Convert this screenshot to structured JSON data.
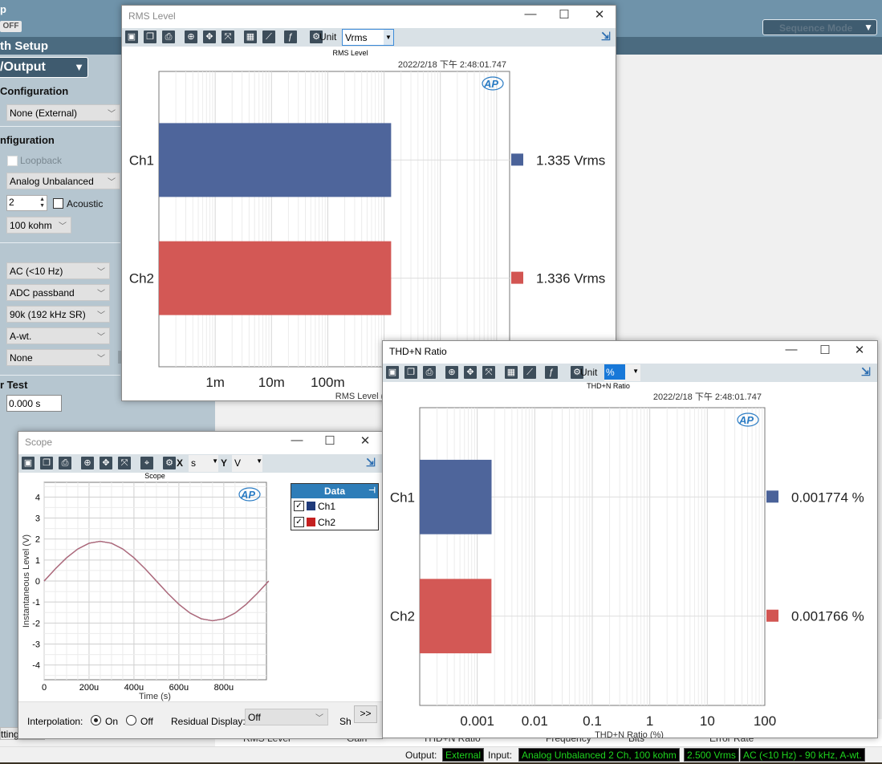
{
  "app": {
    "top_label": "p",
    "off_button": "OFF",
    "path_setup_title": "th Setup",
    "io_dropdown": "/Output",
    "sequence_mode": "Sequence Mode",
    "settings_button": "ttings"
  },
  "left_panel": {
    "section1_title": "Configuration",
    "section1_select": "None (External)",
    "section2_title": "nfiguration",
    "loopback_label": "Loopback",
    "connector_select": "Analog Unbalanced",
    "channels_value": "2",
    "acoustic_label": "Acoustic",
    "impedance_select": "100 kohm",
    "coupling_select": "AC (<10 Hz)",
    "bandpass_select": "ADC passband",
    "lowpass_select": "90k (192 kHz SR)",
    "weighting_select": "A-wt.",
    "filter_select": "None",
    "section3_title": "r Test",
    "delay_value": "0.000 s"
  },
  "bottom_tabs": [
    "RMS Level",
    "Gain",
    "THD+N Ratio",
    "Frequency",
    "Bits",
    "Error Rate"
  ],
  "status": {
    "output_label": "Output:",
    "output_value": "External",
    "input_label": "Input:",
    "input_value": "Analog Unbalanced 2 Ch, 100 kohm",
    "range_value": "2.500 Vrms",
    "filter_value": "AC (<10 Hz) - 90 kHz, A-wt.",
    "badge_text_color": "#1ed41e"
  },
  "toolbar_icons": [
    "save-icon",
    "copy-icon",
    "print-icon",
    "zoom-icon",
    "pan-icon",
    "fit-icon",
    "table-icon",
    "graph-options-icon",
    "function-icon",
    "settings-icon"
  ],
  "colors": {
    "ch1": "#4a6299",
    "ch2": "#d25552",
    "scope_ch1": "#1f3a7a",
    "scope_ch2": "#c42020",
    "toolbar_bg": "#d9e1e6",
    "data_header": "#2e7db8"
  },
  "rms_window": {
    "title": "RMS Level",
    "unit_label": "Unit",
    "unit_value": "Vrms",
    "chart_title": "RMS Level",
    "timestamp": "2022/2/18 下午 2:48:01.747",
    "logo": "AP"
  },
  "thd_window": {
    "title": "THD+N Ratio",
    "unit_label": "Unit",
    "unit_value": "%",
    "chart_title": "THD+N Ratio",
    "timestamp": "2022/2/18 下午 2:48:01.747",
    "logo": "AP"
  },
  "scope_window": {
    "title": "Scope",
    "x_label": "X",
    "x_unit": "s",
    "y_label": "Y",
    "y_unit": "V",
    "chart_title": "Scope",
    "logo": "AP",
    "legend_title": "Data",
    "legend_items": [
      {
        "name": "Ch1",
        "checked": true
      },
      {
        "name": "Ch2",
        "checked": true
      }
    ],
    "interpolation_label": "Interpolation:",
    "interp_on": "On",
    "interp_off": "Off",
    "interp_selected": "On",
    "residual_label": "Residual Display:",
    "residual_value": "Off",
    "show_label": "Sh",
    "more_button": ">>"
  },
  "chart_data": [
    {
      "type": "bar",
      "orientation": "horizontal",
      "title": "RMS Level",
      "xlabel": "RMS Level (Vrms)",
      "xscale": "log",
      "xlim": [
        0.0001,
        170
      ],
      "xticks": [
        {
          "v": 0.001,
          "label": "1m"
        },
        {
          "v": 0.01,
          "label": "10m"
        },
        {
          "v": 0.1,
          "label": "100m"
        }
      ],
      "categories": [
        "Ch1",
        "Ch2"
      ],
      "values": [
        1.335,
        1.336
      ],
      "value_labels": [
        "1.335  Vrms",
        "1.336  Vrms"
      ],
      "grid": true
    },
    {
      "type": "bar",
      "orientation": "horizontal",
      "title": "THD+N Ratio",
      "xlabel": "THD+N Ratio (%)",
      "xscale": "log",
      "xlim": [
        0.0001,
        100
      ],
      "xticks": [
        {
          "v": 0.001,
          "label": "0.001"
        },
        {
          "v": 0.01,
          "label": "0.01"
        },
        {
          "v": 0.1,
          "label": "0.1"
        },
        {
          "v": 1,
          "label": "1"
        },
        {
          "v": 10,
          "label": "10"
        },
        {
          "v": 100,
          "label": "100"
        }
      ],
      "categories": [
        "Ch1",
        "Ch2"
      ],
      "values": [
        0.001774,
        0.001766
      ],
      "value_labels": [
        "0.001774  %",
        "0.001766  %"
      ],
      "grid": true
    },
    {
      "type": "line",
      "title": "Scope",
      "xlabel": "Time (s)",
      "ylabel": "Instantaneous Level (V)",
      "xlim": [
        0,
        0.00099
      ],
      "ylim": [
        -4.7,
        4.7
      ],
      "xticks": [
        {
          "v": 0,
          "label": "0"
        },
        {
          "v": 0.0002,
          "label": "200u"
        },
        {
          "v": 0.0004,
          "label": "400u"
        },
        {
          "v": 0.0006,
          "label": "600u"
        },
        {
          "v": 0.0008,
          "label": "800u"
        }
      ],
      "yticks": [
        4,
        3,
        2,
        1,
        0,
        -1,
        -2,
        -3,
        -4
      ],
      "x": [
        0,
        5e-05,
        0.0001,
        0.00015,
        0.0002,
        0.00025,
        0.0003,
        0.00035,
        0.0004,
        0.00045,
        0.0005,
        0.00055,
        0.0006,
        0.00065,
        0.0007,
        0.00075,
        0.0008,
        0.00085,
        0.0009,
        0.00095,
        0.001
      ],
      "series": [
        {
          "name": "Ch1",
          "values": [
            0,
            0.58,
            1.11,
            1.53,
            1.8,
            1.89,
            1.8,
            1.53,
            1.11,
            0.58,
            0,
            -0.58,
            -1.11,
            -1.53,
            -1.8,
            -1.89,
            -1.8,
            -1.53,
            -1.11,
            -0.58,
            0
          ]
        },
        {
          "name": "Ch2",
          "values": [
            0,
            0.58,
            1.11,
            1.53,
            1.8,
            1.89,
            1.8,
            1.53,
            1.11,
            0.58,
            0,
            -0.58,
            -1.11,
            -1.53,
            -1.8,
            -1.89,
            -1.8,
            -1.53,
            -1.11,
            -0.58,
            0
          ]
        }
      ],
      "grid": true
    }
  ]
}
